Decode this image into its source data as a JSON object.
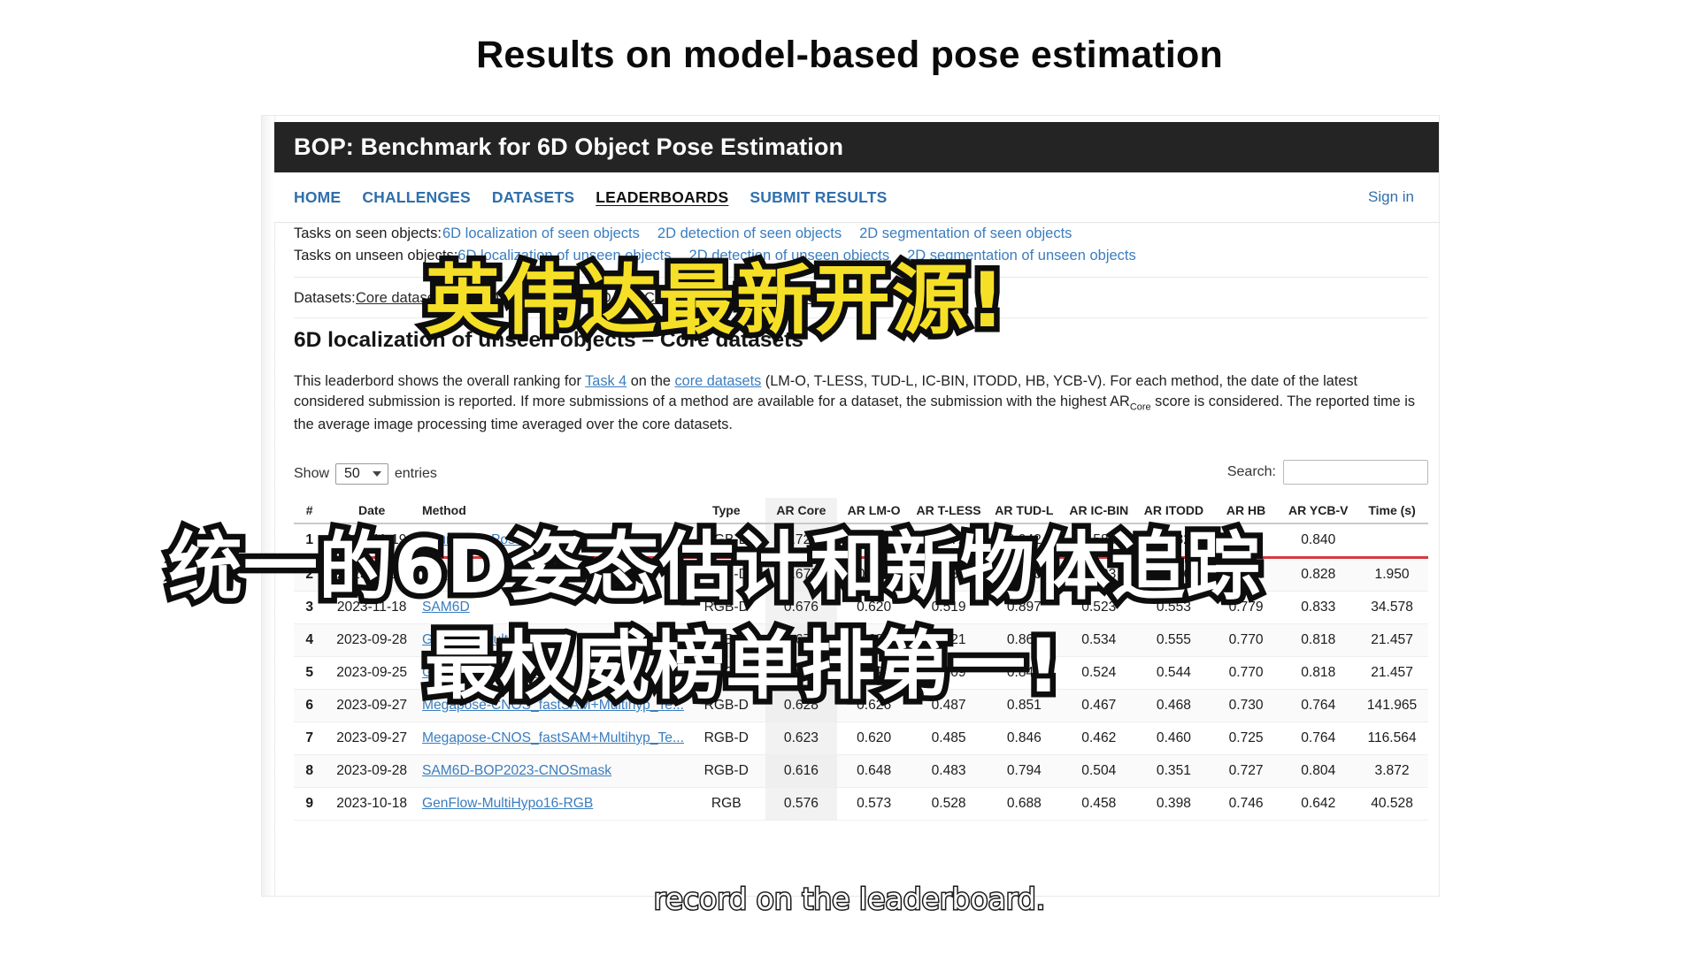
{
  "slide": {
    "title": "Results on model-based pose estimation",
    "caption_line1": "英伟达最新开源!",
    "caption_line2": "统一的6D姿态估计和新物体追踪",
    "caption_line3": "最权威榜单排第一!",
    "subtitle_en": "record on the leaderboard."
  },
  "site": {
    "banner_title": "BOP: Benchmark for 6D Object Pose Estimation",
    "signin": "Sign in",
    "nav": [
      {
        "label": "HOME",
        "active": false
      },
      {
        "label": "CHALLENGES",
        "active": false
      },
      {
        "label": "DATASETS",
        "active": false
      },
      {
        "label": "LEADERBOARDS",
        "active": true
      },
      {
        "label": "SUBMIT RESULTS",
        "active": false
      }
    ],
    "tasks_seen_label": "Tasks on seen objects:",
    "tasks_seen_links": [
      "6D localization of seen objects",
      "2D detection of seen objects",
      "2D segmentation of seen objects"
    ],
    "tasks_unseen_label": "Tasks on unseen objects:",
    "tasks_unseen_links": [
      "6D localization of unseen objects",
      "2D detection of unseen objects",
      "2D segmentation of unseen objects"
    ],
    "datasets_label": "Datasets:",
    "datasets_links": [
      "Core datasets",
      "LM-O",
      "T-LESS",
      "TUD-L",
      "IC-BIN",
      "ITODD",
      "HB",
      "YCB-V"
    ]
  },
  "section": {
    "heading": "6D localization of unseen objects – Core datasets",
    "desc_1": "This leaderbord shows the overall ranking for ",
    "desc_link_1": "Task 4",
    "desc_2": " on the ",
    "desc_link_2": "core datasets",
    "desc_3": " (LM-O, T-LESS, TUD-L, IC-BIN, ITODD, HB, YCB-V). For each method, the date of the latest considered submission is reported. If more submissions of a method are available for a dataset, the submission with the highest AR",
    "desc_sub": "Core",
    "desc_4": " score is considered. The reported time is the average image processing time averaged over the core datasets."
  },
  "controls": {
    "show_prefix": "Show",
    "show_value": "50",
    "show_suffix": "entries",
    "search_label": "Search:",
    "search_value": "",
    "search_placeholder": ""
  },
  "table": {
    "columns": [
      "#",
      "Date",
      "Method",
      "Type",
      "AR Core",
      "AR LM-O",
      "AR T-LESS",
      "AR TUD-L",
      "AR IC-BIN",
      "AR ITODD",
      "AR HB",
      "AR YCB-V",
      "Time (s)"
    ],
    "rows": [
      {
        "rank": "1",
        "date": "2023-11-19",
        "method": "FoundationPose",
        "type": "RGB-D",
        "vals": [
          "0.722",
          "0.613",
          "0.572",
          "0.942",
          "0.583",
          "0.582",
          "0.791",
          "0.840",
          ""
        ]
      },
      {
        "rank": "2",
        "date": "2023-11-17",
        "method": "PoMZ",
        "type": "RGB-D",
        "vals": [
          "0.677",
          "0.611",
          "0.531",
          "0.886",
          "0.503",
          "0.556",
          "0.754",
          "0.828",
          "1.950"
        ]
      },
      {
        "rank": "3",
        "date": "2023-11-18",
        "method": "SAM6D",
        "type": "RGB-D",
        "vals": [
          "0.676",
          "0.620",
          "0.519",
          "0.897",
          "0.523",
          "0.553",
          "0.779",
          "0.833",
          "34.578"
        ]
      },
      {
        "rank": "4",
        "date": "2023-09-28",
        "method": "GenFlow-MultiHypo16",
        "type": "RGB-D",
        "vals": [
          "0.673",
          "0.634",
          "0.521",
          "0.860",
          "0.534",
          "0.555",
          "0.770",
          "0.818",
          "21.457"
        ]
      },
      {
        "rank": "5",
        "date": "2023-09-25",
        "method": "GenFlow-MultiHypo",
        "type": "RGB-D",
        "vals": [
          "0.662",
          "0.622",
          "0.509",
          "0.849",
          "0.524",
          "0.544",
          "0.770",
          "0.818",
          "21.457"
        ]
      },
      {
        "rank": "6",
        "date": "2023-09-27",
        "method": "Megapose-CNOS_fastSAM+Multihyp_Te...",
        "type": "RGB-D",
        "vals": [
          "0.628",
          "0.626",
          "0.487",
          "0.851",
          "0.467",
          "0.468",
          "0.730",
          "0.764",
          "141.965"
        ]
      },
      {
        "rank": "7",
        "date": "2023-09-27",
        "method": "Megapose-CNOS_fastSAM+Multihyp_Te...",
        "type": "RGB-D",
        "vals": [
          "0.623",
          "0.620",
          "0.485",
          "0.846",
          "0.462",
          "0.460",
          "0.725",
          "0.764",
          "116.564"
        ]
      },
      {
        "rank": "8",
        "date": "2023-09-28",
        "method": "SAM6D-BOP2023-CNOSmask",
        "type": "RGB-D",
        "vals": [
          "0.616",
          "0.648",
          "0.483",
          "0.794",
          "0.504",
          "0.351",
          "0.727",
          "0.804",
          "3.872"
        ]
      },
      {
        "rank": "9",
        "date": "2023-10-18",
        "method": "GenFlow-MultiHypo16-RGB",
        "type": "RGB",
        "vals": [
          "0.576",
          "0.573",
          "0.528",
          "0.688",
          "0.458",
          "0.398",
          "0.746",
          "0.642",
          "40.528"
        ]
      }
    ]
  },
  "colors": {
    "banner_bg": "#242424",
    "link": "#3a7dbf",
    "highlight_rule": "#d63a3f",
    "caption_yellow": "#f5e027",
    "caption_white": "#ffffff"
  }
}
